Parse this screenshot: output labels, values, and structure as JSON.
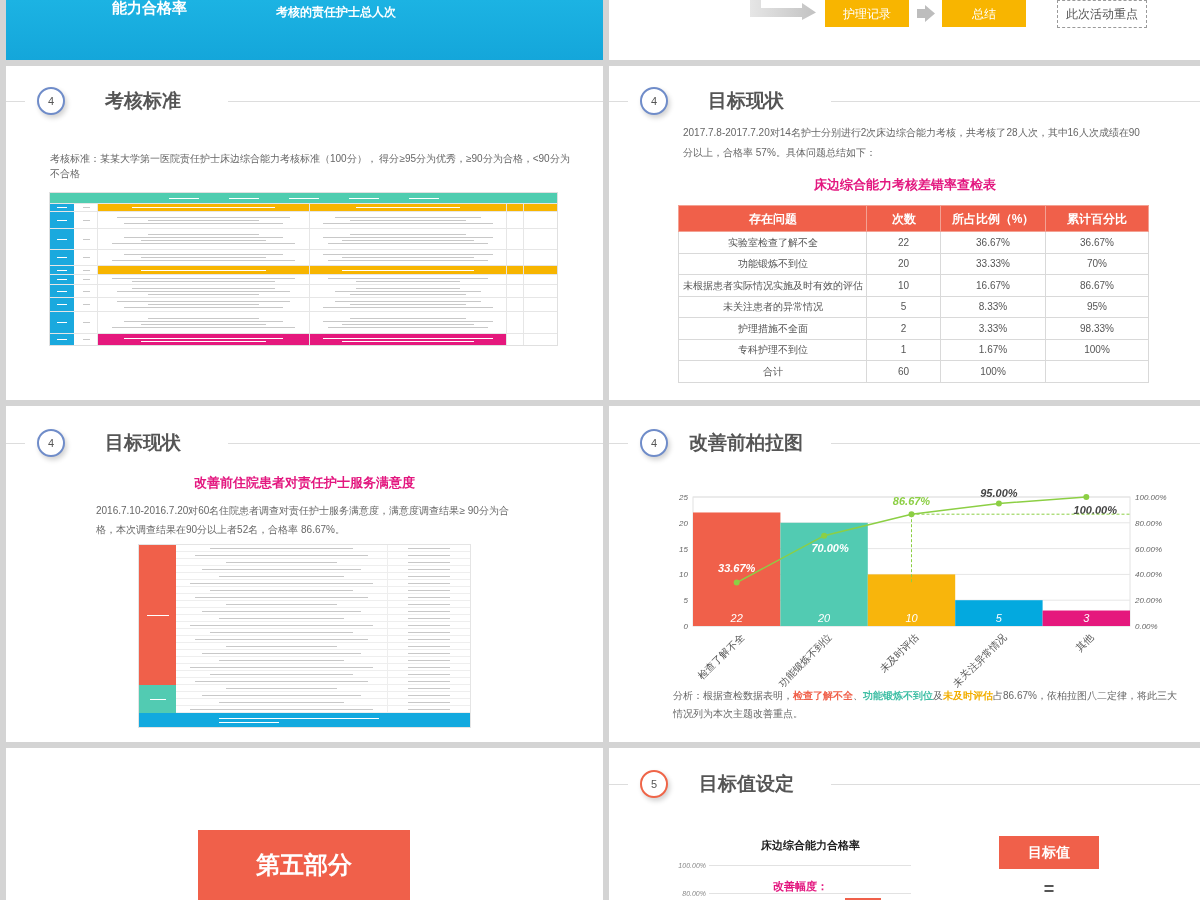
{
  "slides": [
    {
      "kind": "formula",
      "label": "能力合格率",
      "denominator": "考核的责任护士总人次"
    },
    {
      "kind": "flow",
      "steps": [
        {
          "label": "护理记录"
        },
        {
          "label": "总结"
        }
      ],
      "note": "此次活动重点"
    },
    {
      "kind": "standard",
      "header": {
        "number": "4",
        "color": "#6f8cc9",
        "title": "考核标准"
      },
      "paragraph": "考核标准：某某大学第一医院责任护士床边综合能力考核标准（100分）， 得分≥95分为优秀，≥90分为合格，<90分为不合格"
    },
    {
      "kind": "table",
      "header": {
        "number": "4",
        "color": "#6f8cc9",
        "title": "目标现状"
      },
      "paragraph": "2017.7.8-2017.7.20对14名护士分别进行2次床边综合能力考核，共考核了28人次，其中16人次成绩在90分以上，合格率 57%。具体问题总结如下：",
      "table": {
        "title": "床边综合能力考核差错率查检表",
        "columns": [
          "存在问题",
          "次数",
          "所占比例（%）",
          "累计百分比"
        ],
        "rows": [
          [
            "实验室检查了解不全",
            "22",
            "36.67%",
            "36.67%"
          ],
          [
            "功能锻炼不到位",
            "20",
            "33.33%",
            "70%"
          ],
          [
            "未根据患者实际情况实施及时有效的评估",
            "10",
            "16.67%",
            "86.67%"
          ],
          [
            "未关注患者的异常情况",
            "5",
            "8.33%",
            "95%"
          ],
          [
            "护理措施不全面",
            "2",
            "3.33%",
            "98.33%"
          ],
          [
            "专科护理不到位",
            "1",
            "1.67%",
            "100%"
          ],
          [
            "合计",
            "60",
            "100%"
          ]
        ]
      }
    },
    {
      "kind": "survey",
      "header": {
        "number": "4",
        "color": "#6f8cc9",
        "title": "目标现状"
      },
      "subtitle": "改善前住院患者对责任护士服务满意度",
      "paragraph": "2016.7.10-2016.7.20对60名住院患者调查对责任护士服务满意度，满意度调查结果≥ 90分为合格，本次调查结果在90分以上者52名，合格率 86.67%。"
    },
    {
      "kind": "pareto",
      "header": {
        "number": "4",
        "color": "#6f8cc9",
        "title": "改善前柏拉图"
      },
      "chart_data": {
        "type": "bar",
        "categories": [
          "检查了解不全",
          "功能锻炼不到位",
          "未及时评估",
          "未关注异常情况",
          "其他"
        ],
        "ylim": [
          0,
          25
        ],
        "yticks": [
          0,
          5,
          10,
          15,
          20,
          25
        ],
        "y2lim": [
          0,
          100
        ],
        "y2ticks": [
          {
            "value": 0,
            "label": "0.00%"
          },
          {
            "value": 20,
            "label": "20.00%"
          },
          {
            "value": 40,
            "label": "40.00%"
          },
          {
            "value": 60,
            "label": "60.00%"
          },
          {
            "value": 80,
            "label": "80.00%"
          },
          {
            "value": 100,
            "label": "100.00%"
          }
        ],
        "grid": true,
        "series": [
          {
            "type": "bar",
            "colors": [
              "#f0604a",
              "#52cbb2",
              "#f8b50c",
              "#03a9df",
              "#e5187d"
            ],
            "values": [
              22,
              20,
              10,
              5,
              3
            ],
            "value_labels": [
              "22",
              "20",
              "10",
              "5",
              "3"
            ]
          },
          {
            "type": "line",
            "axis": "y2",
            "color": "#8ccf44",
            "marker": true,
            "values": [
              33.67,
              70,
              86.67,
              95,
              100
            ],
            "value_labels": [
              "33.67%",
              "70.00%",
              "86.67%",
              "95.00%",
              "100.00%"
            ]
          }
        ],
        "annotations": [
          {
            "x": "未及时评估"
          }
        ]
      },
      "analysis": [
        {
          "text": "分析：根据查检数据表明，"
        },
        {
          "text": "检查了解不全",
          "color": "#f0604a"
        },
        {
          "text": "、"
        },
        {
          "text": "功能锻炼不到位",
          "color": "#3fbfa5"
        },
        {
          "text": "及"
        },
        {
          "text": "未及时评估",
          "color": "#f2ae00"
        },
        {
          "text": "占86.67%，依柏拉图八二定律，将此三大情况列为本次主题改善重点。"
        }
      ]
    },
    {
      "kind": "section",
      "label": "第五部分"
    },
    {
      "kind": "target",
      "header": {
        "number": "5",
        "color": "#ef6548",
        "title": "目标值设定"
      },
      "chart_title": "床边综合能力合格率",
      "yticks": [
        "100.00%",
        "80.00%"
      ],
      "callout": "改善幅度：",
      "target_label": "目标值",
      "equals": "="
    }
  ]
}
